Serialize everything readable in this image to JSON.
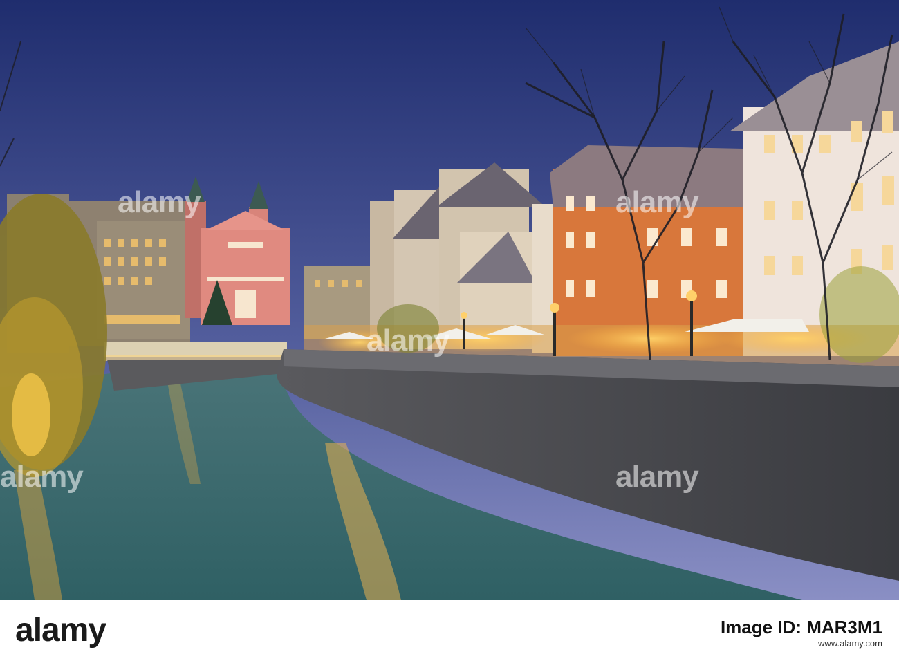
{
  "photo": {
    "subject": "",
    "colors": {
      "sky_top": "#2a3a7a",
      "sky_bottom": "#7a86c8",
      "water": "#3e6f75",
      "wall": "#4a4a50",
      "glow": "#ffc14a",
      "church": "#e08a80",
      "orange_building": "#d8773b"
    }
  },
  "watermark": {
    "brand": "alamy"
  },
  "footer": {
    "logo": "alamy",
    "image_id_label": "Image ID: MAR3M1",
    "url": "www.alamy.com"
  }
}
